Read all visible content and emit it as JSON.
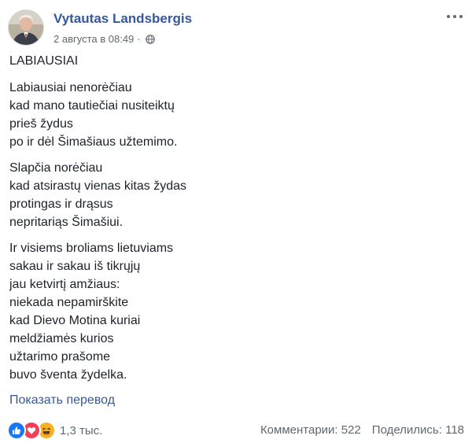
{
  "post": {
    "author": "Vytautas Landsbergis",
    "date": "2 августа в 08:49",
    "separator": "·",
    "privacy_icon": "globe-icon",
    "menu_icon": "more-options-icon",
    "title": "LABIAUSIAI",
    "stanzas": [
      [
        "Labiausiai nenorėčiau",
        "kad mano tautiečiai nusiteiktų",
        "prieš žydus",
        "po ir dėl Šimašiaus užtemimo."
      ],
      [
        "Slapčia norėčiau",
        "kad atsirastų vienas kitas žydas",
        "protingas ir drąsus",
        "nepritariąs Šimašiui."
      ],
      [
        "Ir visiems broliams lietuviams",
        "sakau ir sakau iš tikrųjų",
        "jau ketvirtį amžiaus:",
        "niekada nepamirškite",
        "kad Dievo Motina kuriai",
        "meldžiamės kurios",
        "užtarimo prašome",
        "buvo šventa žydelka."
      ]
    ],
    "translate_link": "Показать перевод"
  },
  "footer": {
    "reaction_icons": [
      "like-icon",
      "love-icon",
      "haha-icon"
    ],
    "reaction_count": "1,3 тыс.",
    "comments": "Комментарии: 522",
    "shares": "Поделились: 118"
  },
  "colors": {
    "link": "#365899",
    "secondary_text": "#606770",
    "like": "#1877f2",
    "love": "#f33e58",
    "haha": "#f7b125"
  }
}
